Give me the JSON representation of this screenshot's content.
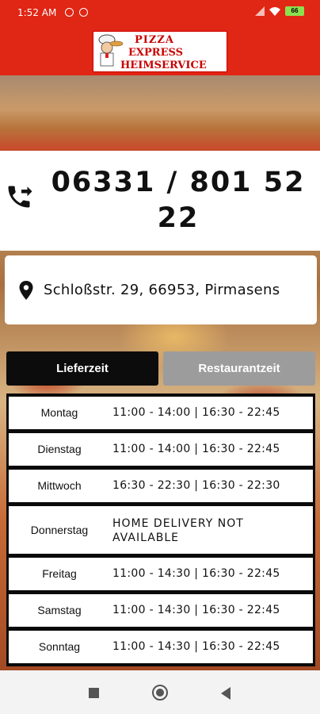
{
  "status_bar": {
    "time": "1:52 AM",
    "battery": "66"
  },
  "logo": {
    "line1": "PIZZA",
    "line2": "EXPRESS",
    "line3": "HEIMSERVICE"
  },
  "phone": {
    "number": "06331 / 801 52 22"
  },
  "address": {
    "text": "Schloßstr. 29, 66953, Pirmasens"
  },
  "tabs": {
    "delivery": "Lieferzeit",
    "restaurant": "Restaurantzeit"
  },
  "schedule": [
    {
      "day": "Montag",
      "hours": "11:00 - 14:00 | 16:30 - 22:45"
    },
    {
      "day": "Dienstag",
      "hours": "11:00 - 14:00 | 16:30 - 22:45"
    },
    {
      "day": "Mittwoch",
      "hours": "16:30 - 22:30 | 16:30 - 22:30"
    },
    {
      "day": "Donnerstag",
      "hours": "HOME DELIVERY NOT AVAILABLE"
    },
    {
      "day": "Freitag",
      "hours": "11:00 - 14:30 | 16:30 - 22:45"
    },
    {
      "day": "Samstag",
      "hours": "11:00 - 14:30 | 16:30 - 22:45"
    },
    {
      "day": "Sonntag",
      "hours": "11:00 - 14:30 | 16:30 - 22:45"
    }
  ],
  "icons": {
    "phone": "phone-forward-icon",
    "location": "location-pin-icon"
  },
  "colors": {
    "brand_red": "#e02614",
    "active_tab": "#0c0c0c",
    "inactive_tab": "#9c9c9c"
  }
}
